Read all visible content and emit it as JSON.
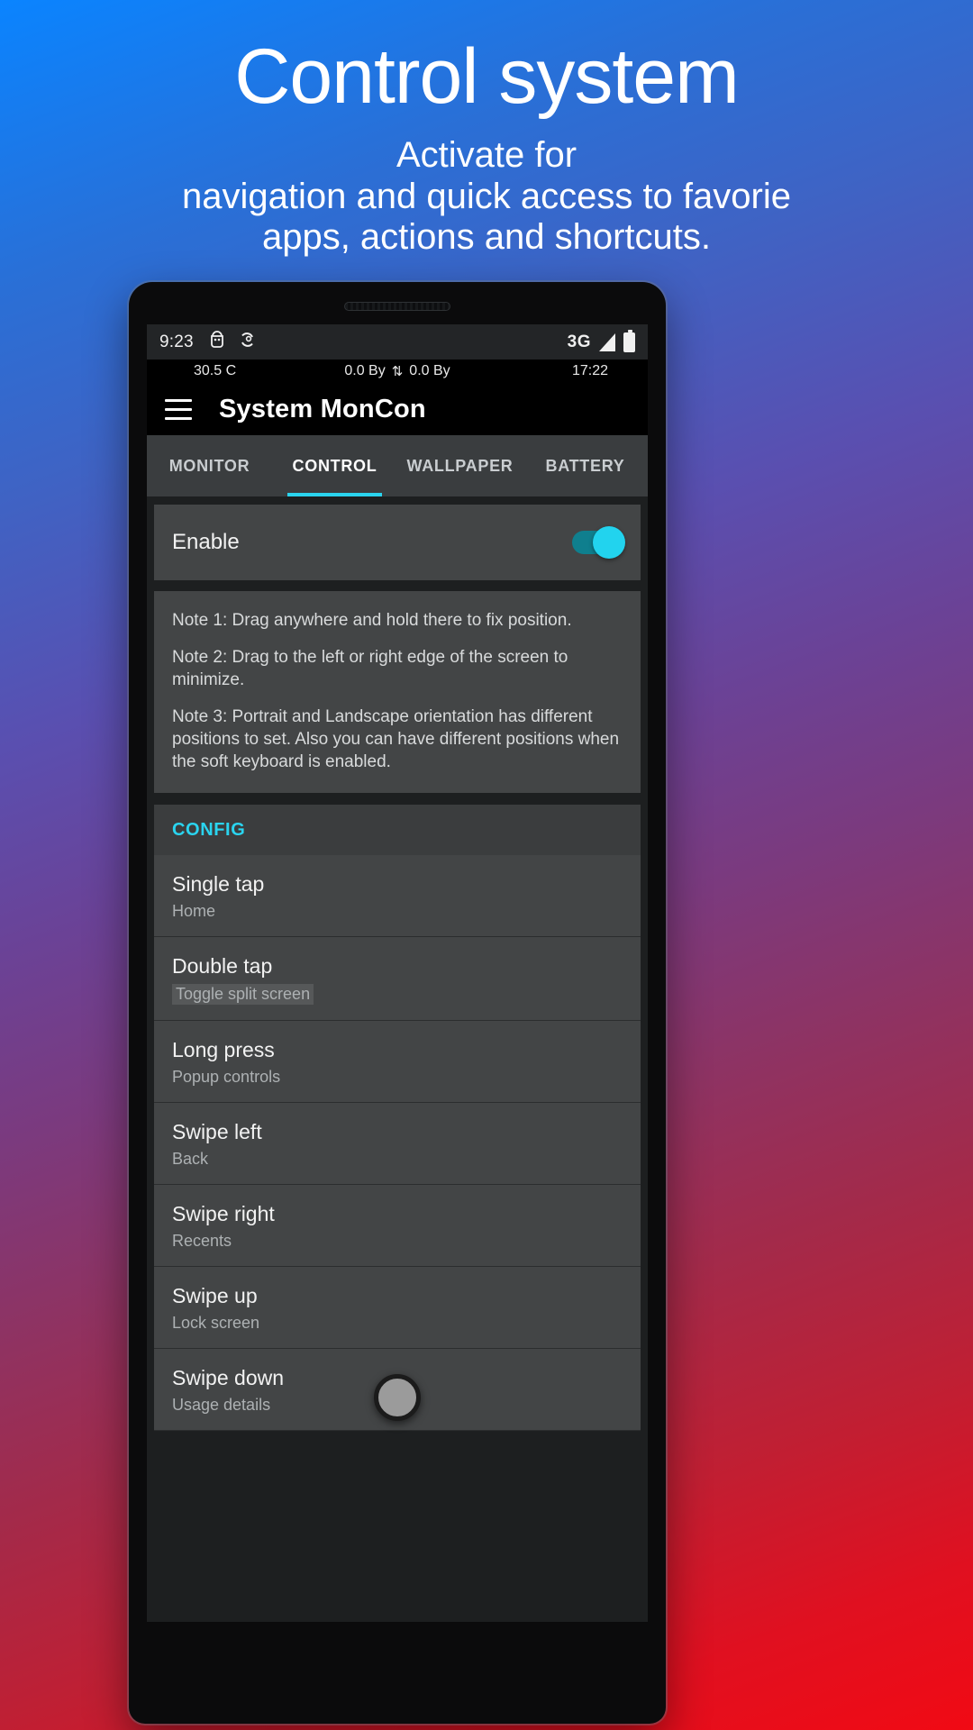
{
  "promo": {
    "title": "Control system",
    "subtitle_lines": [
      "Activate for",
      "navigation and quick access to favorie",
      "apps, actions and shortcuts."
    ]
  },
  "statusbar": {
    "time": "9:23",
    "icon_left_1": "android-debug-icon",
    "icon_left_2": "sync-icon",
    "network": "3G",
    "signal_icon": "signal-bars-icon",
    "battery_icon": "battery-full-icon"
  },
  "substatus": {
    "temperature": "30.5 C",
    "down": "0.0 By",
    "arrows": "⇅",
    "up": "0.0 By",
    "clock": "17:22"
  },
  "toolbar": {
    "menu_icon": "hamburger-menu-icon",
    "title": "System MonCon"
  },
  "tabs": [
    {
      "label": "MONITOR",
      "active": false
    },
    {
      "label": "CONTROL",
      "active": true
    },
    {
      "label": "WALLPAPER",
      "active": false
    },
    {
      "label": "BATTERY",
      "active": false
    }
  ],
  "enable": {
    "label": "Enable",
    "state": "on"
  },
  "notes": [
    "Note 1: Drag anywhere and hold there to fix position.",
    "Note 2: Drag to the left or right edge of the screen to minimize.",
    "Note 3: Portrait and Landscape orientation has different positions to set. Also you can have different positions when the soft keyboard is enabled."
  ],
  "config": {
    "header": "CONFIG",
    "items": [
      {
        "title": "Single tap",
        "value": "Home",
        "highlight": false
      },
      {
        "title": "Double tap",
        "value": "Toggle split screen",
        "highlight": true
      },
      {
        "title": "Long press",
        "value": "Popup controls",
        "highlight": false
      },
      {
        "title": "Swipe left",
        "value": "Back",
        "highlight": false
      },
      {
        "title": "Swipe right",
        "value": "Recents",
        "highlight": false
      },
      {
        "title": "Swipe up",
        "value": "Lock screen",
        "highlight": false
      },
      {
        "title": "Swipe down",
        "value": "Usage details",
        "highlight": false
      }
    ]
  },
  "overlay": {
    "bubble_icon": "floating-control-bubble"
  },
  "colors": {
    "accent": "#2ad4ef",
    "toggle_on": "#22d3ee",
    "surface": "#434546",
    "background": "#1d1f20"
  }
}
